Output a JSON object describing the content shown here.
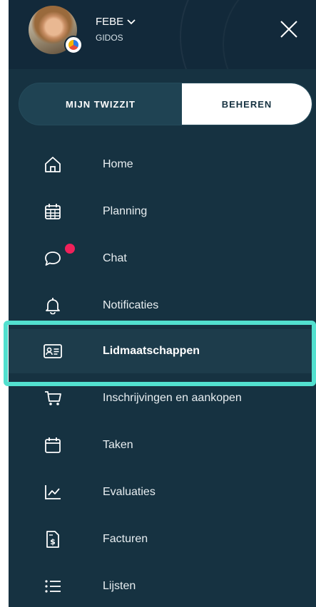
{
  "header": {
    "user_name": "FEBE",
    "organization": "GIDOS",
    "avatar_icon": "user-avatar",
    "close_icon": "close-icon"
  },
  "tabs": {
    "left": "MIJN TWIZZIT",
    "right": "BEHEREN",
    "selected": "BEHEREN"
  },
  "menu": {
    "items": [
      {
        "label": "Home",
        "icon": "home-icon"
      },
      {
        "label": "Planning",
        "icon": "calendar-grid-icon"
      },
      {
        "label": "Chat",
        "icon": "chat-bubble-icon"
      },
      {
        "label": "Notificaties",
        "icon": "bell-icon"
      },
      {
        "label": "Lidmaatschappen",
        "icon": "id-card-icon"
      },
      {
        "label": "Inschrijvingen en aankopen",
        "icon": "shopping-cart-icon"
      },
      {
        "label": "Taken",
        "icon": "calendar-icon"
      },
      {
        "label": "Evaluaties",
        "icon": "line-chart-icon"
      },
      {
        "label": "Facturen",
        "icon": "invoice-icon"
      },
      {
        "label": "Lijsten",
        "icon": "list-icon"
      }
    ],
    "active": "Lidmaatschappen"
  },
  "colors": {
    "panel_bg": "#163241",
    "header_bg": "#12293a",
    "highlight": "#52e0cf",
    "chat_badge": "#f0215a"
  }
}
